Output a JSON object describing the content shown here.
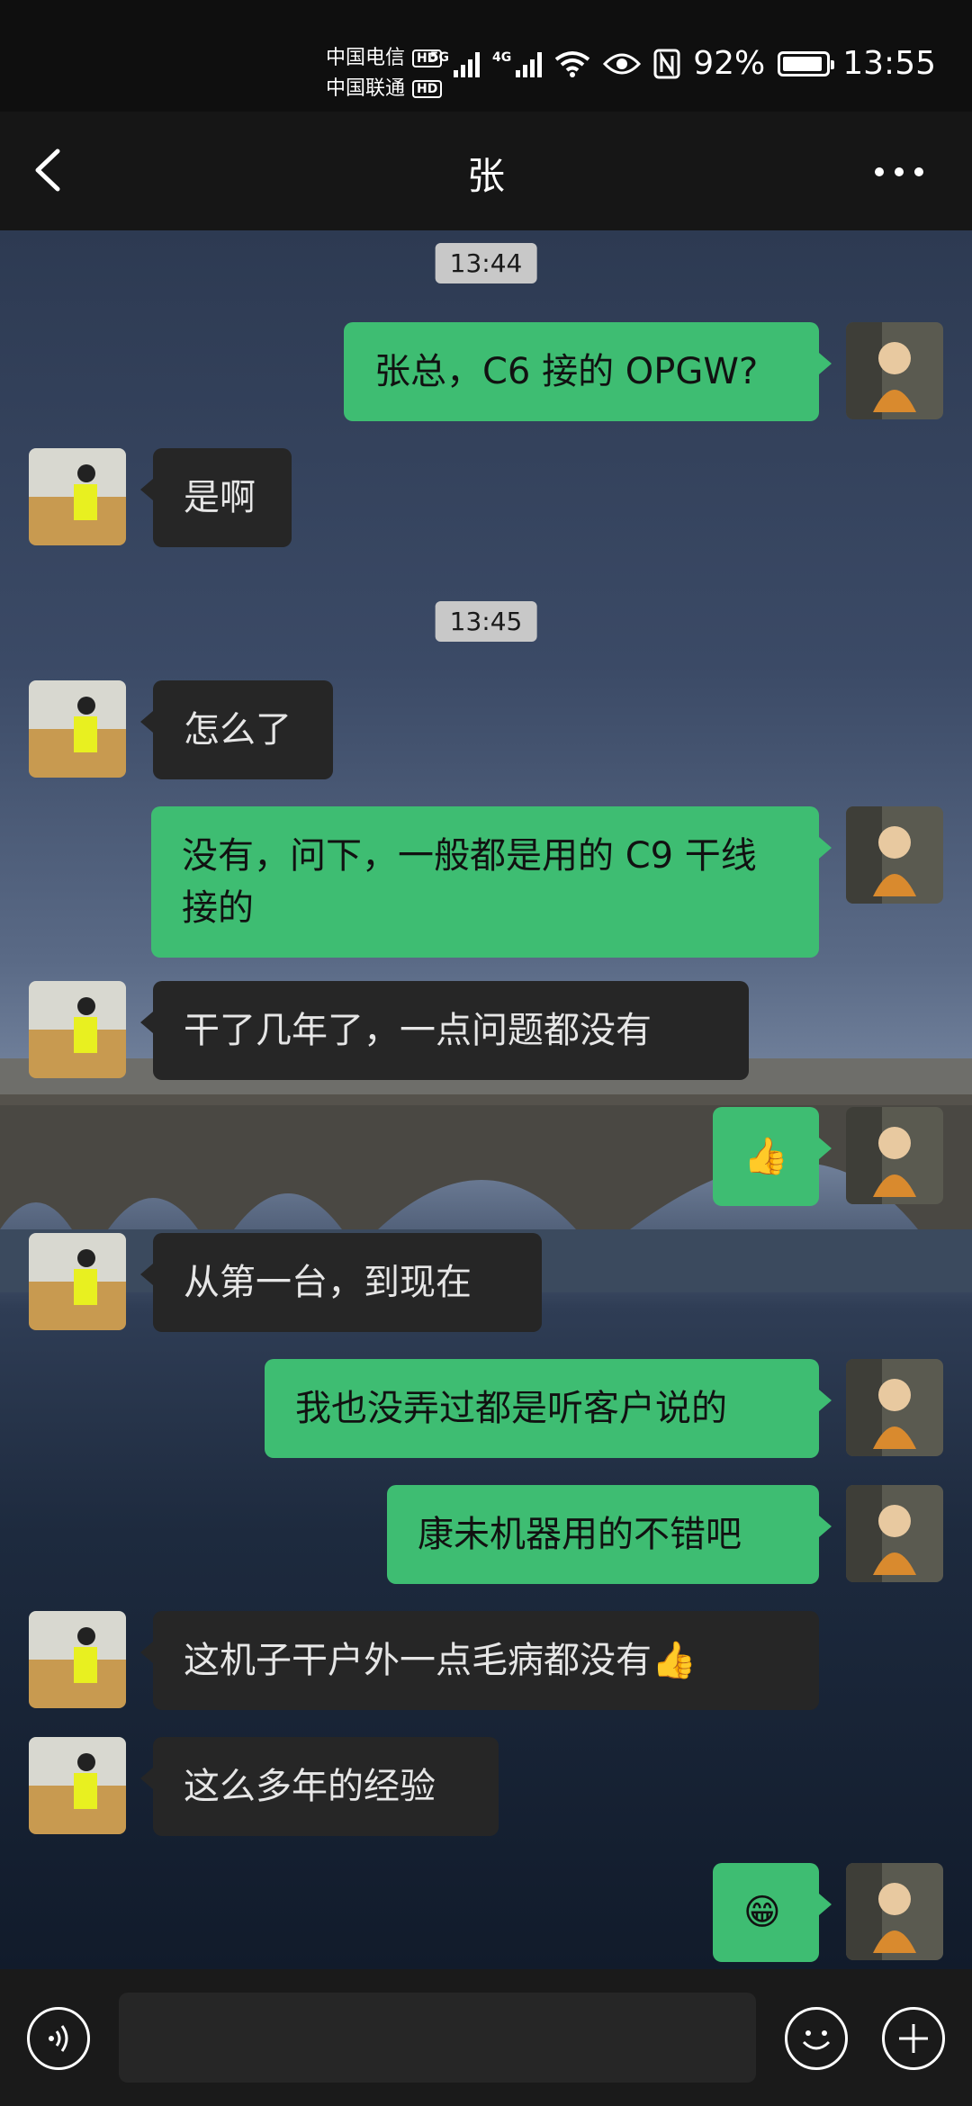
{
  "status_bar": {
    "carrier1": "中国电信",
    "carrier2": "中国联通",
    "hd_badge": "HD",
    "net1": "5G",
    "net2": "4G",
    "battery_percent": "92%",
    "battery_level": 0.92,
    "time": "13:55"
  },
  "header": {
    "title": "张"
  },
  "messages": [
    {
      "type": "time",
      "text": "13:44"
    },
    {
      "type": "out",
      "text": "张总，C6 接的 OPGW?"
    },
    {
      "type": "in",
      "text": "是啊"
    },
    {
      "type": "time",
      "text": "13:45"
    },
    {
      "type": "in",
      "text": "怎么了"
    },
    {
      "type": "out",
      "text": "没有，问下，一般都是用的 C9 干线接的"
    },
    {
      "type": "in",
      "text": "干了几年了，一点问题都没有"
    },
    {
      "type": "out",
      "text": "👍"
    },
    {
      "type": "in",
      "text": "从第一台，到现在"
    },
    {
      "type": "out",
      "text": "我也没弄过都是听客户说的"
    },
    {
      "type": "out",
      "text": "康未机器用的不错吧"
    },
    {
      "type": "in",
      "text": "这机子干户外一点毛病都没有👍"
    },
    {
      "type": "in",
      "text": "这么多年的经验"
    },
    {
      "type": "out",
      "text": "😁"
    }
  ],
  "input": {
    "placeholder": ""
  },
  "colors": {
    "outgoing": "#3ebd72",
    "incoming": "#262626"
  }
}
